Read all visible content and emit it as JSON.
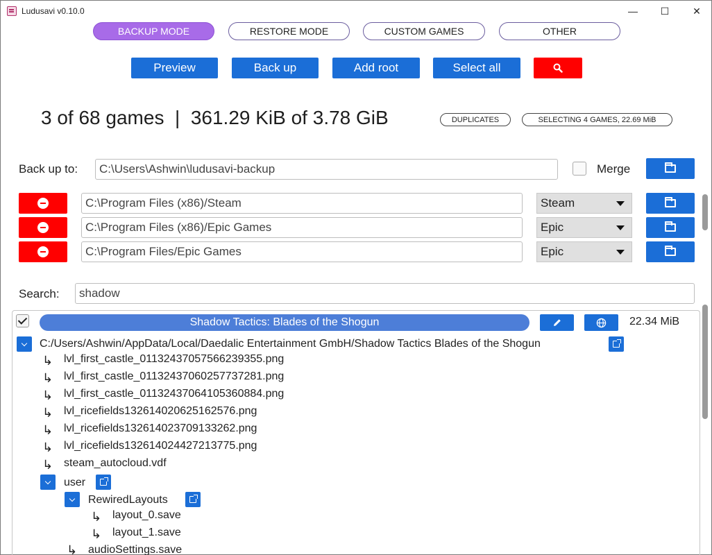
{
  "window": {
    "title": "Ludusavi v0.10.0",
    "minimize_glyph": "—",
    "maximize_glyph": "☐",
    "close_glyph": "✕"
  },
  "modes": [
    {
      "label": "BACKUP MODE",
      "active": true
    },
    {
      "label": "RESTORE MODE",
      "active": false
    },
    {
      "label": "CUSTOM GAMES",
      "active": false
    },
    {
      "label": "OTHER",
      "active": false
    }
  ],
  "actions": {
    "preview": "Preview",
    "back_up": "Back up",
    "add_root": "Add root",
    "select_all": "Select all",
    "search_icon": "search-icon"
  },
  "summary": {
    "text": "3 of 68 games  |  361.29 KiB of 3.78 GiB",
    "duplicates": "DUPLICATES",
    "selecting": "SELECTING 4 GAMES, 22.69 MiB"
  },
  "backup_target": {
    "label": "Back up to:",
    "path": "C:\\Users\\Ashwin\\ludusavi-backup",
    "merge_label": "Merge",
    "merge_checked": false
  },
  "roots": [
    {
      "path": "C:\\Program Files (x86)/Steam",
      "store": "Steam"
    },
    {
      "path": "C:\\Program Files (x86)/Epic Games",
      "store": "Epic"
    },
    {
      "path": "C:\\Program Files/Epic Games",
      "store": "Epic"
    }
  ],
  "search": {
    "label": "Search:",
    "value": "shadow"
  },
  "game": {
    "checked": true,
    "title": "Shadow Tactics: Blades of the Shogun",
    "size": "22.34 MiB",
    "tree": {
      "root_path": "C:/Users/Ashwin/AppData/Local/Daedalic Entertainment GmbH/Shadow Tactics Blades of the Shogun",
      "files": [
        "lvl_first_castle_01132437057566239355.png",
        "lvl_first_castle_01132437060257737281.png",
        "lvl_first_castle_01132437064105360884.png",
        "lvl_ricefields132614020625162576.png",
        "lvl_ricefields132614023709133262.png",
        "lvl_ricefields132614024427213775.png",
        "steam_autocloud.vdf"
      ],
      "user_folder": "user",
      "rewired_folder": "RewiredLayouts",
      "rewired_files": [
        "layout_0.save",
        "layout_1.save"
      ],
      "partial_file": "audioSettings.save"
    }
  },
  "colors": {
    "accent_blue": "#1b6ed7",
    "active_mode": "#a86be8",
    "danger_red": "#ff0000",
    "game_bar": "#4d7ed8"
  }
}
